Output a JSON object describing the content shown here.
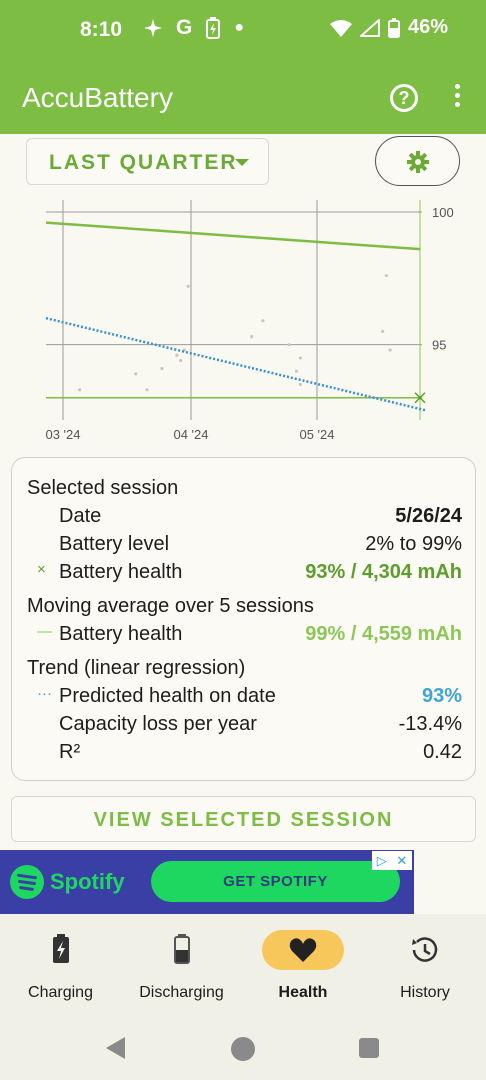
{
  "status_bar": {
    "time": "8:10",
    "battery_pct": "46%"
  },
  "app_bar": {
    "title": "AccuBattery",
    "help_icon": "help-circle-icon",
    "menu_icon": "more-vert-icon"
  },
  "range_selector": {
    "value": "LAST QUARTER"
  },
  "chart_data": {
    "type": "scatter",
    "x_tick_labels": [
      "03 '24",
      "04 '24",
      "05 '24"
    ],
    "y_tick_labels": [
      "100",
      "95"
    ],
    "ylim": [
      92.5,
      100
    ],
    "grid": true,
    "series": [
      {
        "kind": "moving-average-line",
        "color": "#7dbd43",
        "points": [
          [
            0,
            99.6
          ],
          [
            1,
            98.6
          ]
        ]
      },
      {
        "kind": "trend-dotted-line",
        "color": "#3a8fd8",
        "points": [
          [
            0,
            96.0
          ],
          [
            1,
            92.9
          ]
        ]
      },
      {
        "kind": "session-points",
        "color": "#c8c8c0",
        "x": [
          0.09,
          0.24,
          0.27,
          0.31,
          0.35,
          0.36,
          0.37,
          0.38,
          0.55,
          0.58,
          0.65,
          0.67,
          0.68,
          0.68,
          0.9,
          0.91,
          0.92
        ],
        "y": [
          93.3,
          93.9,
          93.3,
          94.1,
          94.6,
          94.4,
          94.8,
          97.2,
          95.3,
          95.9,
          95.0,
          94.0,
          94.5,
          93.5,
          95.5,
          97.6,
          94.8
        ]
      },
      {
        "kind": "selected-session",
        "color": "#5c9e2d",
        "points": [
          [
            1.0,
            93.0
          ]
        ]
      }
    ]
  },
  "details": {
    "selected_session_title": "Selected session",
    "date_label": "Date",
    "date_value": "5/26/24",
    "battery_level_label": "Battery level",
    "battery_level_value": "2% to 99%",
    "health_marker": "×",
    "health_label": "Battery health",
    "health_value": "93% / 4,304 mAh",
    "moving_avg_title": "Moving average over 5 sessions",
    "ma_marker": "—",
    "ma_health_label": "Battery health",
    "ma_health_value": "99% / 4,559 mAh",
    "trend_title": "Trend (linear regression)",
    "predicted_marker": "···",
    "predicted_label": "Predicted health on date",
    "predicted_value": "93%",
    "capacity_loss_label": "Capacity loss per year",
    "capacity_loss_value": "-13.4%",
    "r2_label": "R²",
    "r2_value": "0.42"
  },
  "view_button": "VIEW SELECTED SESSION",
  "ad": {
    "brand": "Spotify",
    "cta": "GET SPOTIFY"
  },
  "bottom_nav": [
    {
      "label": "Charging",
      "icon": "battery-charging-icon",
      "active": false
    },
    {
      "label": "Discharging",
      "icon": "battery-icon",
      "active": false
    },
    {
      "label": "Health",
      "icon": "heart-icon",
      "active": true
    },
    {
      "label": "History",
      "icon": "history-icon",
      "active": false
    }
  ]
}
